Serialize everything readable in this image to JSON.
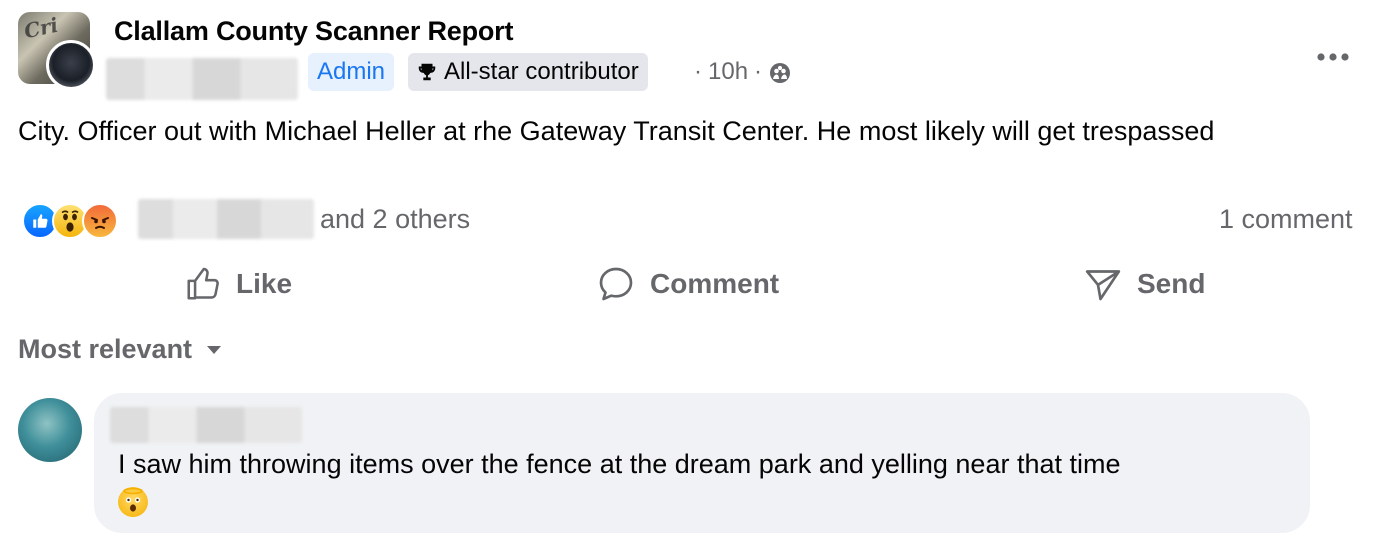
{
  "post": {
    "group_name": "Clallam County Scanner Report",
    "admin_badge": "Admin",
    "contributor_badge": "All-star contributor",
    "time": "10h",
    "separator": "·",
    "body": "City. Officer out with Michael Heller at rhe Gateway Transit Center. He most likely will get trespassed",
    "group_avatar_text": "Cri",
    "privacy_icon": "members-icon"
  },
  "reactions": {
    "types": [
      "like",
      "wow",
      "angry"
    ],
    "others_text": "and 2 others",
    "comment_count": "1 comment"
  },
  "actions": {
    "like_label": "Like",
    "comment_label": "Comment",
    "send_label": "Send"
  },
  "comments": {
    "sort_label": "Most relevant",
    "items": [
      {
        "text": "I saw him throwing items over the fence at the dream park and yelling near that time",
        "emoji": "shocked-face-emoji"
      }
    ]
  },
  "colors": {
    "accent": "#1877f2",
    "secondary_text": "#65676b",
    "bubble": "#f0f2f5",
    "badge_bg": "#e4e6eb",
    "admin_bg": "#e7f0fd"
  }
}
